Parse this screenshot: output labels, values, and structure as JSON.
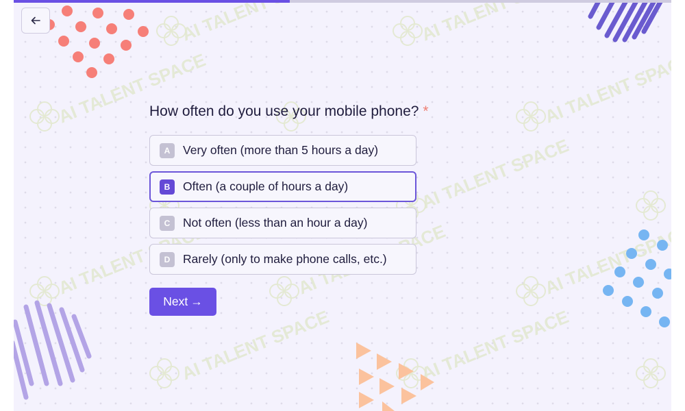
{
  "progress": {
    "value": 0.42,
    "fill_color": "#6a50e4",
    "track_color": "#cfcbe0"
  },
  "nav": {
    "back_icon": "arrow-left-icon"
  },
  "question": {
    "text": "How often do you use your mobile phone?",
    "required_mark": "*"
  },
  "options": [
    {
      "key": "A",
      "label": "Very often (more than 5 hours a day)",
      "selected": false
    },
    {
      "key": "B",
      "label": "Often (a couple of hours a day)",
      "selected": true
    },
    {
      "key": "C",
      "label": "Not often (less than an hour a day)",
      "selected": false
    },
    {
      "key": "D",
      "label": "Rarely (only to make phone calls, etc.)",
      "selected": false
    }
  ],
  "next_button": {
    "label": "Next",
    "arrow": "→"
  },
  "watermark": "AI TALENT SPACE",
  "colors": {
    "accent": "#6a50e4",
    "required": "#ee7f73",
    "background": "#f4f2fd",
    "coral_dots": "#f67f78",
    "blue_dots": "#76b5f2",
    "peach_triangles": "#fbc29d",
    "purple_stripes": "#6a5bcf",
    "lavender_stripes": "#b3a4e6"
  }
}
